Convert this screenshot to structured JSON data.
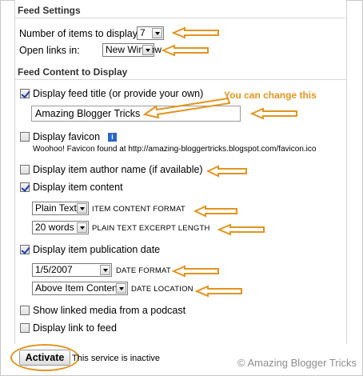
{
  "sections": {
    "feed_settings": "Feed Settings",
    "feed_content": "Feed Content to Display"
  },
  "items_to_display": {
    "label": "Number of items to display:",
    "value": "7"
  },
  "open_links": {
    "label": "Open links in:",
    "value": "New Window"
  },
  "display_title": {
    "label": "Display feed title (or provide your own)",
    "checked": true,
    "value": "Amazing Blogger Tricks"
  },
  "annotation_note": "You can change this",
  "favicon": {
    "label": "Display favicon",
    "checked": false,
    "info_glyph": "i",
    "found_text": "Woohoo! Favicon found at http://amazing-bloggertricks.blogspot.com/favicon.ico"
  },
  "author": {
    "label": "Display item author name (if available)",
    "checked": false
  },
  "item_content": {
    "label": "Display item content",
    "checked": true,
    "format_value": "Plain Text",
    "format_label": "ITEM CONTENT FORMAT",
    "excerpt_value": "20 words",
    "excerpt_label": "PLAIN TEXT EXCERPT LENGTH"
  },
  "pub_date": {
    "label": "Display item publication date",
    "checked": true,
    "format_value": "1/5/2007",
    "format_label": "DATE FORMAT",
    "location_value": "Above Item Content",
    "location_label": "DATE LOCATION"
  },
  "podcast": {
    "label": "Show linked media from a podcast",
    "checked": false
  },
  "link_to_feed": {
    "label": "Display link to feed",
    "checked": false
  },
  "activate": {
    "label": "Activate",
    "status": "This service is inactive"
  },
  "watermark": "© Amazing Blogger Tricks",
  "colors": {
    "annotation": "#e3941e",
    "checkmark": "#1b3fb0",
    "info_icon": "#2a66c8"
  }
}
